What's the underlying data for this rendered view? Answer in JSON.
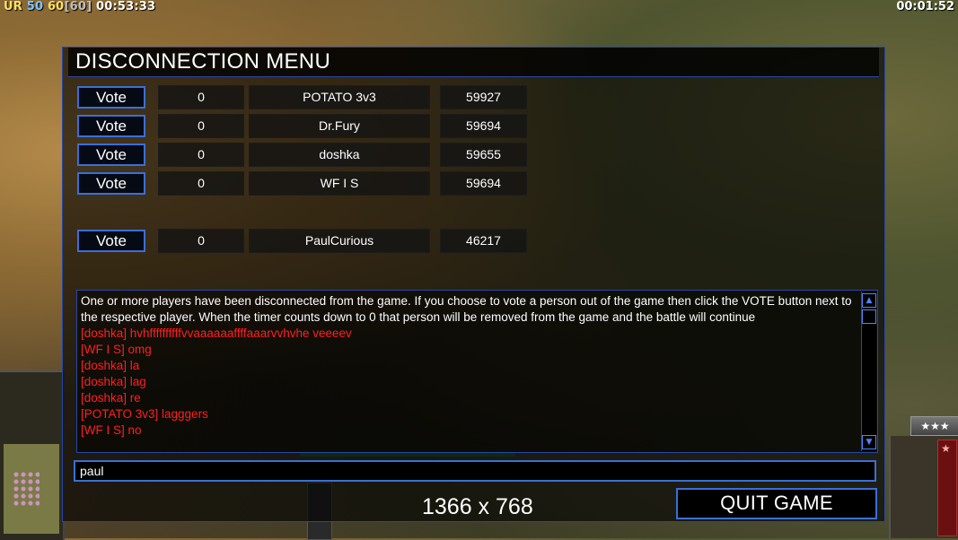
{
  "hud": {
    "top_left_label": "UR",
    "fps_a": "50",
    "fps_b": "60",
    "fps_c": "[60]",
    "game_time": "00:53:33",
    "timer": "00:01:52",
    "rank_stars": "★★★"
  },
  "panel": {
    "title": "DISCONNECTION MENU",
    "players": [
      {
        "vote_label": "Vote",
        "votes": "0",
        "name": "POTATO 3v3",
        "id": "59927"
      },
      {
        "vote_label": "Vote",
        "votes": "0",
        "name": "Dr.Fury",
        "id": "59694"
      },
      {
        "vote_label": "Vote",
        "votes": "0",
        "name": "doshka",
        "id": "59655"
      },
      {
        "vote_label": "Vote",
        "votes": "0",
        "name": "WF I S",
        "id": "59694"
      },
      {
        "vote_label": "Vote",
        "votes": "0",
        "name": "PaulCurious",
        "id": "46217"
      }
    ],
    "chat": {
      "system_message": "One or more players have been disconnected from the game. If you choose to vote a person out of the game then click the VOTE button next to the respective player. When the timer counts down to 0 that person will be removed from the game and the battle will continue",
      "messages": [
        "[doshka] hvhffffffffffvvaaaaaaffffaaarvvhvhe veeeev",
        "[WF I S] omg",
        "[doshka] la",
        "[doshka] lag",
        "[doshka] re",
        "[POTATO 3v3] lagggers",
        "[WF I S] no"
      ],
      "system_color": "#ffffff",
      "message_color": "#ff2020"
    },
    "input_value": "paul",
    "resolution": "1366 x 768",
    "quit_label": "QUIT GAME",
    "accent_color": "#3a6fd8"
  }
}
